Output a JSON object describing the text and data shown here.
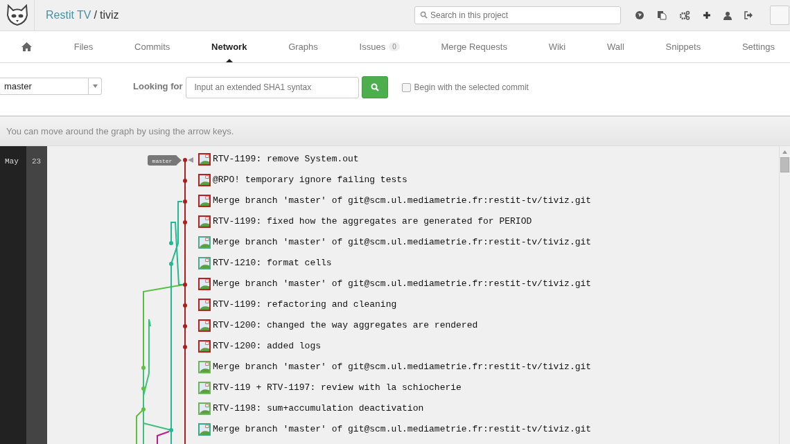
{
  "header": {
    "group": "Restit TV",
    "separator": "/",
    "project": "tiviz",
    "search": {
      "placeholder": "Search in this project"
    }
  },
  "tabs": [
    {
      "kind": "home",
      "selected": false
    },
    {
      "kind": "text",
      "label": "Files",
      "selected": false
    },
    {
      "kind": "text",
      "label": "Commits",
      "selected": false
    },
    {
      "kind": "text",
      "label": "Network",
      "selected": true
    },
    {
      "kind": "text",
      "label": "Graphs",
      "selected": false
    },
    {
      "kind": "text",
      "label": "Issues",
      "count": "0",
      "selected": false
    },
    {
      "kind": "text",
      "label": "Merge Requests",
      "selected": false
    },
    {
      "kind": "text",
      "label": "Wiki",
      "selected": false
    },
    {
      "kind": "text",
      "label": "Wall",
      "selected": false
    },
    {
      "kind": "text",
      "label": "Snippets",
      "selected": false
    },
    {
      "kind": "text",
      "label": "Settings",
      "selected": false
    }
  ],
  "toolbar": {
    "branch": "master",
    "looking_for_label": "Looking for",
    "sha_field": {
      "placeholder": "Input an extended SHA1 syntax"
    },
    "begin_checkbox": {
      "label": "Begin with the selected commit",
      "checked": false
    }
  },
  "notice": "You can move around the graph by using the arrow keys.",
  "graph": {
    "month": "May",
    "day": "23",
    "branch_label": "master",
    "commits": [
      {
        "message": "RTV-1199: remove System.out",
        "color": "#b22222"
      },
      {
        "message": "@RPO! temporary ignore failing tests",
        "color": "#b22222"
      },
      {
        "message": "Merge branch 'master' of git@scm.ul.mediametrie.fr:restit-tv/tiviz.git",
        "color": "#b22222"
      },
      {
        "message": "RTV-1199: fixed how the aggregates are generated for PERIOD",
        "color": "#b22222"
      },
      {
        "message": "Merge branch 'master' of git@scm.ul.mediametrie.fr:restit-tv/tiviz.git",
        "color": "#4fa88a"
      },
      {
        "message": "RTV-1210: format cells",
        "color": "#4fa88a"
      },
      {
        "message": "Merge branch 'master' of git@scm.ul.mediametrie.fr:restit-tv/tiviz.git",
        "color": "#b22222"
      },
      {
        "message": "RTV-1199: refactoring and cleaning",
        "color": "#b22222"
      },
      {
        "message": "RTV-1200: changed the way aggregates are rendered",
        "color": "#b22222"
      },
      {
        "message": "RTV-1200: added logs",
        "color": "#b22222"
      },
      {
        "message": "Merge branch 'master' of git@scm.ul.mediametrie.fr:restit-tv/tiviz.git",
        "color": "#6cb35a"
      },
      {
        "message": "RTV-119 + RTV-1197: review with la schiocherie",
        "color": "#6cb35a"
      },
      {
        "message": "RTV-1198: sum+accumulation deactivation",
        "color": "#6cb35a"
      },
      {
        "message": "Merge branch 'master' of git@scm.ul.mediametrie.fr:restit-tv/tiviz.git",
        "color": "#3aa88a"
      }
    ]
  }
}
